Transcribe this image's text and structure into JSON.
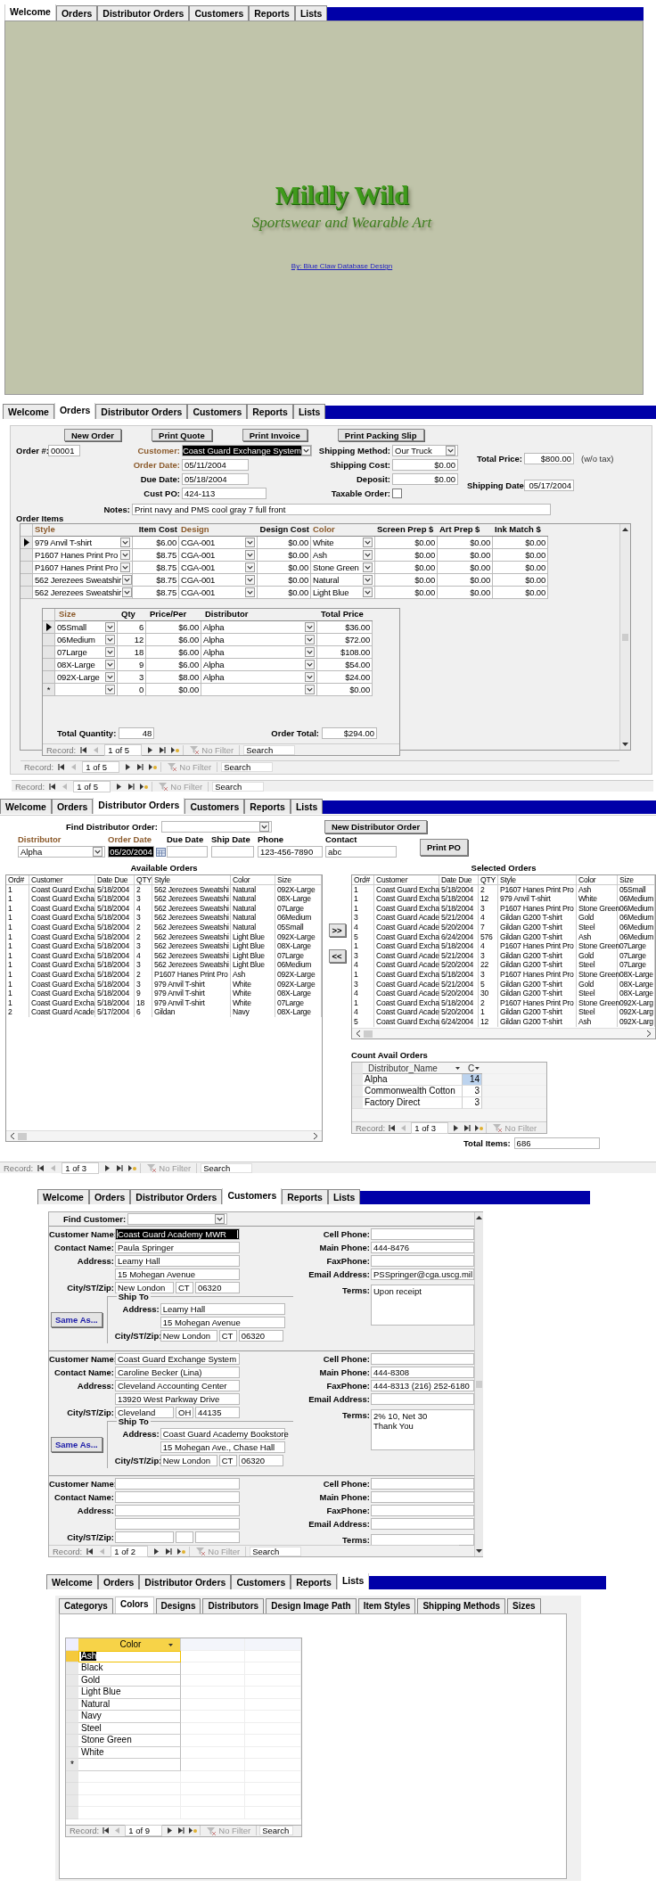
{
  "screens": [
    {
      "kind": "welcome",
      "tabs": [
        {
          "label": "Welcome",
          "selected": true
        },
        {
          "label": "Orders",
          "selected": false
        },
        {
          "label": "Distributor Orders",
          "selected": false
        },
        {
          "label": "Customers",
          "selected": false
        },
        {
          "label": "Reports",
          "selected": false
        },
        {
          "label": "Lists",
          "selected": false
        }
      ],
      "title": "Mildly Wild",
      "subtitle": "Sportswear and Wearable Art",
      "credit_link": "By: Blue Claw Database Design"
    },
    {
      "kind": "orders",
      "tabs": [
        {
          "label": "Welcome",
          "selected": false
        },
        {
          "label": "Orders",
          "selected": true
        },
        {
          "label": "Distributor Orders",
          "selected": false
        },
        {
          "label": "Customers",
          "selected": false
        },
        {
          "label": "Reports",
          "selected": false
        },
        {
          "label": "Lists",
          "selected": false
        }
      ],
      "buttons": [
        "New Order",
        "Print Quote",
        "Print Invoice",
        "Print Packing Slip"
      ],
      "field_columns": [
        [
          {
            "label": "Order #:",
            "value": "00001",
            "kind": "text",
            "accent": false,
            "selected": false
          }
        ],
        [
          {
            "label": "Customer:",
            "value": "Coast Guard Exchange System",
            "kind": "combo",
            "accent": true,
            "selected": true
          },
          {
            "label": "Order Date:",
            "value": "05/11/2004",
            "kind": "text",
            "accent": true,
            "selected": false
          },
          {
            "label": "Due Date:",
            "value": "05/18/2004",
            "kind": "text",
            "accent": false,
            "selected": false
          },
          {
            "label": "Cust PO:",
            "value": "424-113",
            "kind": "text",
            "accent": false,
            "selected": false
          }
        ],
        [
          {
            "label": "Shipping Method:",
            "value": "Our Truck",
            "kind": "combo",
            "accent": false,
            "selected": false
          },
          {
            "label": "Shipping Cost:",
            "value": "$0.00",
            "kind": "money",
            "accent": false,
            "selected": false
          },
          {
            "label": "Deposit:",
            "value": "$0.00",
            "kind": "money",
            "accent": false,
            "selected": false
          },
          {
            "label": "Taxable Order:",
            "kind": "check",
            "checked": false,
            "accent": false
          }
        ],
        [
          {
            "label": "Total Price:",
            "value": "$800.00",
            "kind": "money",
            "note": "(w/o tax)",
            "accent": false,
            "selected": false
          },
          {
            "label": "Shipping Date:",
            "value": "05/17/2004",
            "kind": "money",
            "accent": false,
            "selected": false
          }
        ]
      ],
      "notes": {
        "label": "Notes:",
        "value": "Print navy and PMS cool gray 7 full front"
      },
      "items_title": "Order Items",
      "items": {
        "columns": [
          {
            "label": "Style",
            "kind": "combo",
            "accent": true
          },
          {
            "label": "Item Cost",
            "kind": "money",
            "accent": false
          },
          {
            "label": "Design",
            "kind": "combo",
            "accent": true
          },
          {
            "label": "Design Cost",
            "kind": "money",
            "accent": false
          },
          {
            "label": "Color",
            "kind": "combo",
            "accent": true
          },
          {
            "label": "Screen Prep $",
            "kind": "money",
            "accent": false
          },
          {
            "label": "Art Prep $",
            "kind": "money",
            "accent": false
          },
          {
            "label": "Ink Match $",
            "kind": "money",
            "accent": false
          }
        ],
        "rows": [
          {
            "current": true,
            "cells": [
              "979 Anvil T-shirt",
              "$6.00",
              "CGA-001",
              "$0.00",
              "White",
              "$0.00",
              "$0.00",
              "$0.00"
            ]
          },
          {
            "current": false,
            "cells": [
              "P1607 Hanes Print Pro",
              "$8.75",
              "CGA-001",
              "$0.00",
              "Ash",
              "$0.00",
              "$0.00",
              "$0.00"
            ]
          },
          {
            "current": false,
            "cells": [
              "P1607 Hanes Print Pro",
              "$8.75",
              "CGA-001",
              "$0.00",
              "Stone Green",
              "$0.00",
              "$0.00",
              "$0.00"
            ]
          },
          {
            "current": false,
            "cells": [
              "562 Jerezees Sweatshir",
              "$8.75",
              "CGA-001",
              "$0.00",
              "Natural",
              "$0.00",
              "$0.00",
              "$0.00"
            ]
          },
          {
            "current": false,
            "cells": [
              "562 Jerezees Sweatshir",
              "$8.75",
              "CGA-001",
              "$0.00",
              "Light Blue",
              "$0.00",
              "$0.00",
              "$0.00"
            ]
          }
        ],
        "sizes": {
          "columns": [
            {
              "label": "Size",
              "kind": "combo",
              "accent": true
            },
            {
              "label": "Qty",
              "kind": "money",
              "accent": false
            },
            {
              "label": "Price/Per",
              "kind": "money",
              "accent": false
            },
            {
              "label": "Distributor",
              "kind": "combo",
              "accent": false
            },
            {
              "label": "Total Price",
              "kind": "money",
              "accent": false
            }
          ],
          "rows": [
            {
              "current": true,
              "cells": [
                "05Small",
                "6",
                "$6.00",
                "Alpha",
                "$36.00"
              ]
            },
            {
              "current": false,
              "cells": [
                "06Medium",
                "12",
                "$6.00",
                "Alpha",
                "$72.00"
              ]
            },
            {
              "current": false,
              "cells": [
                "07Large",
                "18",
                "$6.00",
                "Alpha",
                "$108.00"
              ]
            },
            {
              "current": false,
              "cells": [
                "08X-Large",
                "9",
                "$6.00",
                "Alpha",
                "$54.00"
              ]
            },
            {
              "current": false,
              "cells": [
                "092X-Large",
                "3",
                "$8.00",
                "Alpha",
                "$24.00"
              ]
            }
          ],
          "new_row": {
            "marker": "*",
            "cells": [
              "",
              "0",
              "$0.00",
              "",
              "$0.00"
            ]
          },
          "total_quantity": {
            "label": "Total Quantity:",
            "value": "48"
          },
          "order_total": {
            "label": "Order Total:",
            "value": "$294.00"
          },
          "nav": {
            "label": "Record:",
            "position": "1 of 5",
            "filter": "No Filter",
            "search_placeholder": "Search"
          }
        },
        "nav": {
          "label": "Record:",
          "position": "1 of 5",
          "filter": "No Filter",
          "search_placeholder": "Search"
        }
      },
      "nav": {
        "label": "Record:",
        "position": "1 of 5",
        "filter": "No Filter",
        "search_placeholder": "Search"
      }
    },
    {
      "kind": "distributor_orders",
      "tabs": [
        {
          "label": "Welcome",
          "selected": false
        },
        {
          "label": "Orders",
          "selected": false
        },
        {
          "label": "Distributor Orders",
          "selected": true
        },
        {
          "label": "Customers",
          "selected": false
        },
        {
          "label": "Reports",
          "selected": false
        },
        {
          "label": "Lists",
          "selected": false
        }
      ],
      "find": {
        "label": "Find Distributor Order:"
      },
      "new_button": "New Distributor Order",
      "header_fields": [
        {
          "label": "Distributor",
          "value": "Alpha",
          "kind": "combo",
          "accent": true,
          "selected": false
        },
        {
          "label": "Order Date",
          "value": "05/20/2004",
          "kind": "date",
          "accent": true,
          "selected": true
        },
        {
          "label": "Due Date",
          "kind": "text",
          "accent": false,
          "selected": false
        },
        {
          "label": "Ship Date",
          "kind": "text",
          "accent": false,
          "selected": false
        },
        {
          "label": "Phone",
          "value": "123-456-7890",
          "kind": "text",
          "accent": false,
          "selected": false
        },
        {
          "label": "Contact",
          "value": "abc",
          "kind": "text",
          "accent": false,
          "selected": false
        }
      ],
      "print_button": "Print PO",
      "available": {
        "title": "Available Orders",
        "columns": [
          "Ord#",
          "Customer",
          "Date Due",
          "QTY",
          "Style",
          "Color",
          "Size"
        ],
        "rows": [
          [
            "1",
            "Coast Guard Excha",
            "5/18/2004",
            "2",
            "562 Jerezees Sweatshi",
            "Natural",
            "092X-Large"
          ],
          [
            "1",
            "Coast Guard Excha",
            "5/18/2004",
            "3",
            "562 Jerezees Sweatshi",
            "Natural",
            "08X-Large"
          ],
          [
            "1",
            "Coast Guard Excha",
            "5/18/2004",
            "4",
            "562 Jerezees Sweatshi",
            "Natural",
            "07Large"
          ],
          [
            "1",
            "Coast Guard Excha",
            "5/18/2004",
            "3",
            "562 Jerezees Sweatshi",
            "Natural",
            "06Medium"
          ],
          [
            "1",
            "Coast Guard Excha",
            "5/18/2004",
            "2",
            "562 Jerezees Sweatshi",
            "Natural",
            "05Small"
          ],
          [
            "1",
            "Coast Guard Excha",
            "5/18/2004",
            "2",
            "562 Jerezees Sweatshi",
            "Light Blue",
            "092X-Large"
          ],
          [
            "1",
            "Coast Guard Excha",
            "5/18/2004",
            "3",
            "562 Jerezees Sweatshi",
            "Light Blue",
            "08X-Large"
          ],
          [
            "1",
            "Coast Guard Excha",
            "5/18/2004",
            "4",
            "562 Jerezees Sweatshi",
            "Light Blue",
            "07Large"
          ],
          [
            "1",
            "Coast Guard Excha",
            "5/18/2004",
            "3",
            "562 Jerezees Sweatshi",
            "Light Blue",
            "06Medium"
          ],
          [
            "1",
            "Coast Guard Excha",
            "5/18/2004",
            "2",
            "P1607 Hanes Print Pro",
            "Ash",
            "092X-Large"
          ],
          [
            "1",
            "Coast Guard Excha",
            "5/18/2004",
            "3",
            "979 Anvil T-shirt",
            "White",
            "092X-Large"
          ],
          [
            "1",
            "Coast Guard Excha",
            "5/18/2004",
            "9",
            "979 Anvil T-shirt",
            "White",
            "08X-Large"
          ],
          [
            "1",
            "Coast Guard Excha",
            "5/18/2004",
            "18",
            "979 Anvil T-shirt",
            "White",
            "07Large"
          ],
          [
            "2",
            "Coast Guard Acade",
            "5/17/2004",
            "6",
            "Gildan",
            "Navy",
            "08X-Large"
          ]
        ]
      },
      "move_buttons": [
        ">>",
        "<<"
      ],
      "selected_orders": {
        "title": "Selected Orders",
        "columns": [
          "Ord#",
          "Customer",
          "Date Due",
          "QTY",
          "Style",
          "Color",
          "Size"
        ],
        "rows": [
          [
            "1",
            "Coast Guard Excha",
            "5/18/2004",
            "2",
            "P1607 Hanes Print Pro",
            "Ash",
            "05Small"
          ],
          [
            "1",
            "Coast Guard Excha",
            "5/18/2004",
            "12",
            "979 Anvil T-shirt",
            "White",
            "06Medium"
          ],
          [
            "1",
            "Coast Guard Excha",
            "5/18/2004",
            "3",
            "P1607 Hanes Print Pro",
            "Stone Green",
            "06Medium"
          ],
          [
            "3",
            "Coast Guard Acade",
            "5/21/2004",
            "4",
            "Gildan G200 T-shirt",
            "Gold",
            "06Medium"
          ],
          [
            "4",
            "Coast Guard Acade",
            "5/20/2004",
            "7",
            "Gildan G200 T-shirt",
            "Steel",
            "06Medium"
          ],
          [
            "5",
            "Coast Guard Excha",
            "6/24/2004",
            "576",
            "Gildan G200 T-shirt",
            "Ash",
            "06Medium"
          ],
          [
            "1",
            "Coast Guard Excha",
            "5/18/2004",
            "4",
            "P1607 Hanes Print Pro",
            "Stone Green",
            "07Large"
          ],
          [
            "3",
            "Coast Guard Acade",
            "5/21/2004",
            "3",
            "Gildan G200 T-shirt",
            "Gold",
            "07Large"
          ],
          [
            "4",
            "Coast Guard Acade",
            "5/20/2004",
            "22",
            "Gildan G200 T-shirt",
            "Steel",
            "07Large"
          ],
          [
            "1",
            "Coast Guard Excha",
            "5/18/2004",
            "3",
            "P1607 Hanes Print Pro",
            "Stone Green",
            "08X-Large"
          ],
          [
            "3",
            "Coast Guard Acade",
            "5/21/2004",
            "5",
            "Gildan G200 T-shirt",
            "Gold",
            "08X-Large"
          ],
          [
            "4",
            "Coast Guard Acade",
            "5/20/2004",
            "30",
            "Gildan G200 T-shirt",
            "Steel",
            "08X-Large"
          ],
          [
            "1",
            "Coast Guard Excha",
            "5/18/2004",
            "2",
            "P1607 Hanes Print Pro",
            "Stone Green",
            "092X-Larg"
          ],
          [
            "4",
            "Coast Guard Acade",
            "5/20/2004",
            "1",
            "Gildan G200 T-shirt",
            "Steel",
            "092X-Larg"
          ],
          [
            "5",
            "Coast Guard Excha",
            "6/24/2004",
            "12",
            "Gildan G200 T-shirt",
            "Ash",
            "092X-Larg"
          ]
        ]
      },
      "count": {
        "title": "Count Avail Orders",
        "columns": [
          "Distributor_Name",
          "C"
        ],
        "rows": [
          {
            "name": "Alpha",
            "count": "14",
            "selected": true
          },
          {
            "name": "Commonwealth Cotton",
            "count": "3",
            "selected": false
          },
          {
            "name": "Factory Direct",
            "count": "3",
            "selected": false
          }
        ],
        "nav": {
          "label": "Record:",
          "position": "1 of 3",
          "filter": "No Filter"
        }
      },
      "total_items": {
        "label": "Total Items:",
        "value": "686"
      },
      "nav": {
        "label": "Record:",
        "position": "1 of 3",
        "filter": "No Filter",
        "search_placeholder": "Search"
      }
    },
    {
      "kind": "customers",
      "tabs": [
        {
          "label": "Welcome",
          "selected": false
        },
        {
          "label": "Orders",
          "selected": false
        },
        {
          "label": "Distributor Orders",
          "selected": false
        },
        {
          "label": "Customers",
          "selected": true
        },
        {
          "label": "Reports",
          "selected": false
        },
        {
          "label": "Lists",
          "selected": false
        }
      ],
      "find": {
        "label": "Find Customer:"
      },
      "records": [
        {
          "left": [
            {
              "label": "Customer Name:",
              "kind": "line",
              "values": [
                "Coast Guard Academy MWR"
              ],
              "selected": true
            },
            {
              "label": "Contact Name:",
              "kind": "line",
              "values": [
                "Paula Springer"
              ],
              "selected": false
            },
            {
              "label": "Address:",
              "kind": "lines2",
              "values": [
                "Leamy Hall",
                "15 Mohegan Avenue"
              ],
              "selected": false
            },
            {
              "label": "City/ST/Zip:",
              "kind": "csz",
              "values": [
                "New London",
                "CT",
                "06320"
              ],
              "selected": false
            }
          ],
          "right": [
            {
              "label": "Cell Phone:",
              "kind": "line"
            },
            {
              "label": "Main Phone:",
              "kind": "line",
              "values": [
                "444-8476"
              ]
            },
            {
              "label": "FaxPhone:",
              "kind": "line"
            },
            {
              "label": "Email Address:",
              "kind": "line",
              "values": [
                "PSSpringer@cga.uscg.mil"
              ]
            },
            {
              "label": "Terms:",
              "kind": "memo",
              "values": [
                "Upon receipt"
              ]
            }
          ],
          "same_as_button": "Same As...",
          "ship_to": {
            "title": "Ship To",
            "fields": [
              {
                "label": "Address:",
                "kind": "lines2",
                "values": [
                  "Leamy Hall",
                  "15 Mohegan Avenue"
                ]
              },
              {
                "label": "City/ST/Zip:",
                "kind": "csz",
                "values": [
                  "New London",
                  "CT",
                  "06320"
                ]
              }
            ]
          }
        },
        {
          "left": [
            {
              "label": "Customer Name:",
              "kind": "line",
              "values": [
                "Coast Guard Exchange System"
              ],
              "selected": false
            },
            {
              "label": "Contact Name:",
              "kind": "line",
              "values": [
                "Caroline Becker (Lina)"
              ],
              "selected": false
            },
            {
              "label": "Address:",
              "kind": "lines2",
              "values": [
                "Cleveland Accounting Center",
                "13920 West Parkway Drive"
              ],
              "selected": false
            },
            {
              "label": "City/ST/Zip:",
              "kind": "csz",
              "values": [
                "Cleveland",
                "OH",
                "44135"
              ],
              "selected": false
            }
          ],
          "right": [
            {
              "label": "Cell Phone:",
              "kind": "line"
            },
            {
              "label": "Main Phone:",
              "kind": "line",
              "values": [
                "444-8308"
              ]
            },
            {
              "label": "FaxPhone:",
              "kind": "line",
              "values": [
                "444-8313   (216) 252-6180"
              ]
            },
            {
              "label": "Email Address:",
              "kind": "line"
            },
            {
              "label": "Terms:",
              "kind": "memo",
              "values": [
                "2% 10, Net 30",
                "Thank You"
              ]
            }
          ],
          "same_as_button": "Same As...",
          "ship_to": {
            "title": "Ship To",
            "fields": [
              {
                "label": "Address:",
                "kind": "lines2",
                "values": [
                  "Coast Guard Academy Bookstore",
                  "15 Mohegan Ave., Chase Hall"
                ]
              },
              {
                "label": "City/ST/Zip:",
                "kind": "csz",
                "values": [
                  "New London",
                  "CT",
                  "06320"
                ]
              }
            ]
          }
        },
        {
          "left": [
            {
              "label": "Customer Name:",
              "kind": "line",
              "selected": false
            },
            {
              "label": "Contact Name:",
              "kind": "line",
              "selected": false
            },
            {
              "label": "Address:",
              "kind": "lines2",
              "selected": false
            },
            {
              "label": "City/ST/Zip:",
              "kind": "csz",
              "selected": false
            }
          ],
          "right": [
            {
              "label": "Cell Phone:",
              "kind": "line"
            },
            {
              "label": "Main Phone:",
              "kind": "line"
            },
            {
              "label": "FaxPhone:",
              "kind": "line"
            },
            {
              "label": "Email Address:",
              "kind": "line"
            },
            {
              "label": "Terms:",
              "kind": "short"
            }
          ]
        }
      ],
      "nav": {
        "label": "Record:",
        "position": "1 of 2",
        "filter": "No Filter",
        "search_placeholder": "Search"
      }
    },
    {
      "kind": "lists",
      "tabs": [
        {
          "label": "Welcome",
          "selected": false
        },
        {
          "label": "Orders",
          "selected": false
        },
        {
          "label": "Distributor Orders",
          "selected": false
        },
        {
          "label": "Customers",
          "selected": false
        },
        {
          "label": "Reports",
          "selected": false
        },
        {
          "label": "Lists",
          "selected": true
        }
      ],
      "inner_tabs": [
        {
          "label": "Categorys",
          "selected": false
        },
        {
          "label": "Colors",
          "selected": true
        },
        {
          "label": "Designs",
          "selected": false
        },
        {
          "label": "Distributors",
          "selected": false
        },
        {
          "label": "Design Image Path",
          "selected": false
        },
        {
          "label": "Item Styles",
          "selected": false
        },
        {
          "label": "Shipping Methods",
          "selected": false
        },
        {
          "label": "Sizes",
          "selected": false
        }
      ],
      "table": {
        "column": "Color",
        "rows": [
          {
            "value": "Ash",
            "selected": true
          },
          {
            "value": "Black",
            "selected": false
          },
          {
            "value": "Gold",
            "selected": false
          },
          {
            "value": "Light Blue",
            "selected": false
          },
          {
            "value": "Natural",
            "selected": false
          },
          {
            "value": "Navy",
            "selected": false
          },
          {
            "value": "Steel",
            "selected": false
          },
          {
            "value": "Stone Green",
            "selected": false
          },
          {
            "value": "White",
            "selected": false
          }
        ],
        "new_row": {
          "marker": "*"
        },
        "nav": {
          "label": "Record:",
          "position": "1 of 9",
          "filter": "No Filter",
          "search_placeholder": "Search"
        }
      }
    }
  ]
}
